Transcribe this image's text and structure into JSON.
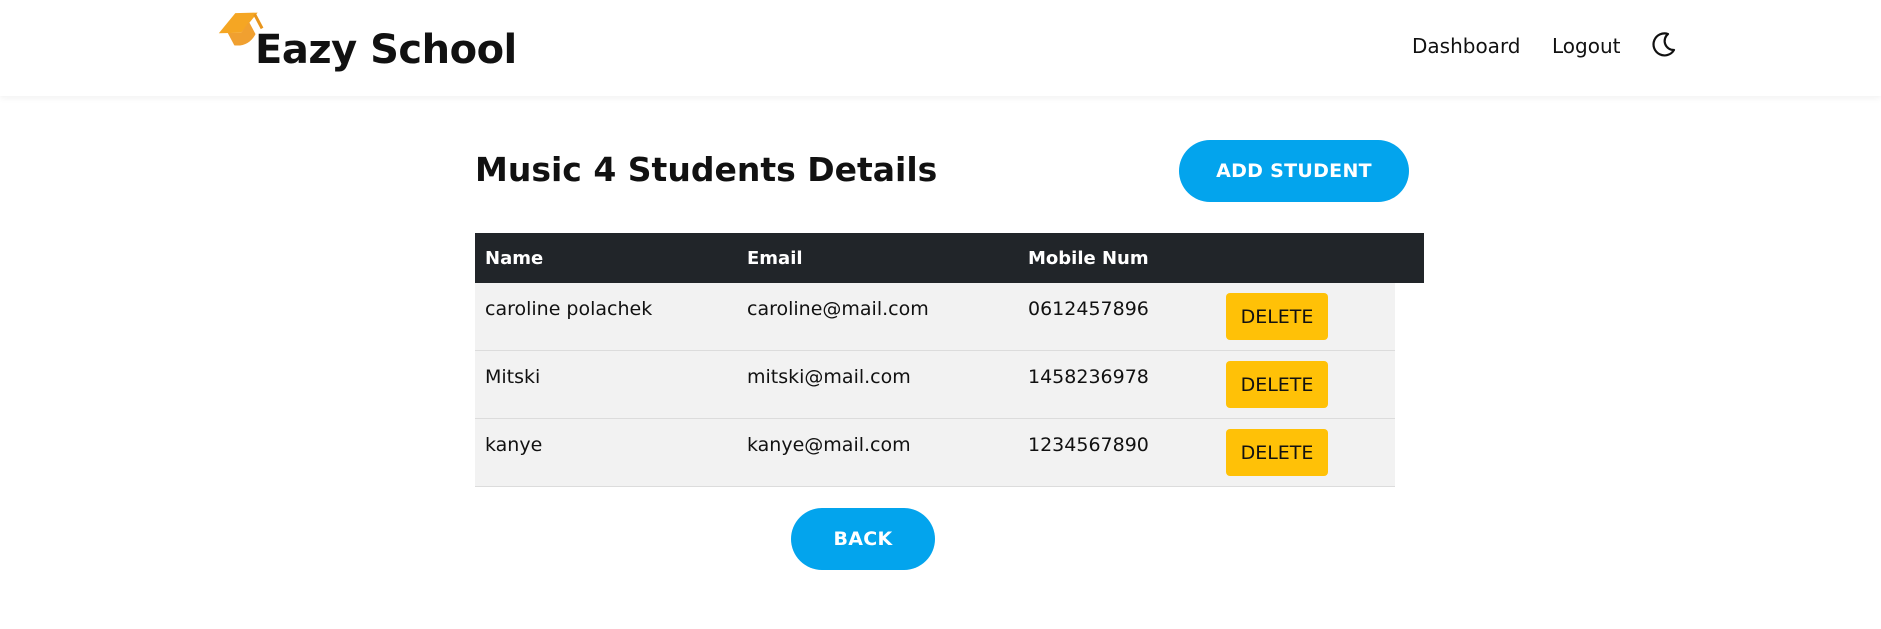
{
  "navbar": {
    "brand": "Eazy School",
    "links": [
      "Dashboard",
      "Logout"
    ],
    "theme_toggle_icon": "moon-icon",
    "logo_icon": "graduation-cap-icon",
    "logo_color": "#f5a623"
  },
  "main": {
    "title": "Music 4 Students Details",
    "add_button": "ADD STUDENT",
    "back_button": "BACK",
    "accent_color": "#03a4ed",
    "delete_color": "#ffc107"
  },
  "table": {
    "headers": [
      "Name",
      "Email",
      "Mobile Num"
    ],
    "rows": [
      {
        "name": "caroline polachek",
        "email": "caroline@mail.com",
        "mobile": "0612457896",
        "action": "DELETE"
      },
      {
        "name": "Mitski",
        "email": "mitski@mail.com",
        "mobile": "1458236978",
        "action": "DELETE"
      },
      {
        "name": "kanye",
        "email": "kanye@mail.com",
        "mobile": "1234567890",
        "action": "DELETE"
      }
    ]
  }
}
